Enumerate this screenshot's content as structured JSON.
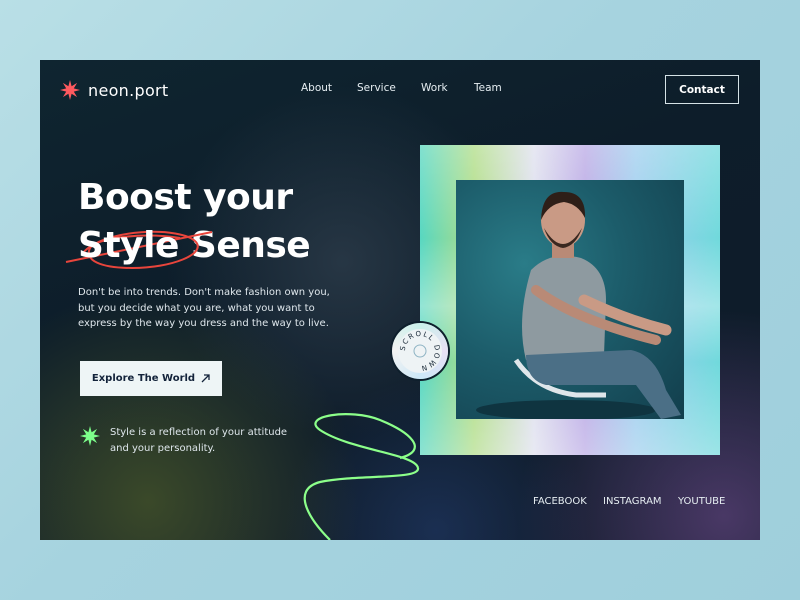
{
  "brand": {
    "name": "neon.port",
    "icon": "starburst-icon",
    "icon_color": "#ff5a5f"
  },
  "nav": {
    "items": [
      "About",
      "Service",
      "Work",
      "Team"
    ],
    "contact_label": "Contact"
  },
  "hero": {
    "headline_line1": "Boost your",
    "headline_word_struck": "Style",
    "headline_word_end": "Sense",
    "description": "Don't be into trends. Don't make fashion own you, but you decide what you are, what you want to express by the way you dress and the way to live.",
    "cta_label": "Explore The World",
    "cta_icon": "arrow-up-right-icon",
    "quote": "Style is a reflection of your attitude and your personality.",
    "quote_icon": "green-star-icon",
    "strike_color": "#e8453c",
    "accent_green": "#8cff8a"
  },
  "scroll_badge": {
    "text": "SCROLL DOWN"
  },
  "social": {
    "links": [
      "FACEBOOK",
      "INSTAGRAM",
      "YOUTUBE"
    ]
  }
}
